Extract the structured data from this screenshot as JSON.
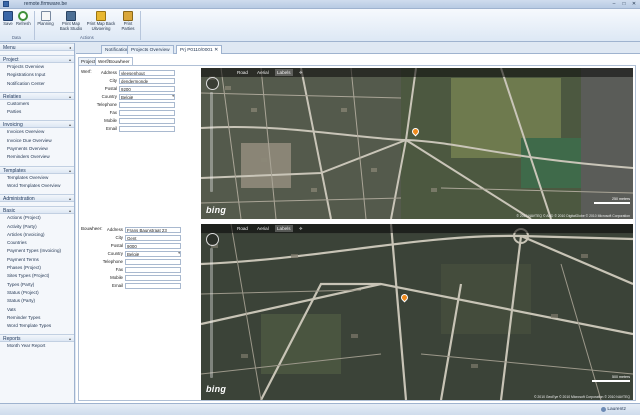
{
  "window": {
    "title": "remote.firmware.be",
    "minimize": "–",
    "maximize": "□",
    "close": "✕"
  },
  "ribbon": {
    "buttons": [
      {
        "label": "Save",
        "icon": "save-icon"
      },
      {
        "label": "Refresh",
        "icon": "refresh-icon"
      },
      {
        "label": "Planning",
        "icon": "planning-icon"
      },
      {
        "label": "Print Map Back Studio",
        "icon": "print-map-studio-icon"
      },
      {
        "label": "Print Map Back Uitvoering",
        "icon": "print-map-uitvoering-icon"
      },
      {
        "label": "Print Parties",
        "icon": "print-parties-icon"
      }
    ],
    "groups": {
      "data": "Data",
      "actions": "Actions"
    }
  },
  "sidebar": {
    "menu": "Menu",
    "sections": [
      {
        "title": "Project",
        "items": [
          "Projects Overview",
          "Registrations Input",
          "Notification Center"
        ]
      },
      {
        "title": "Relaties",
        "items": [
          "Customers",
          "Parties"
        ]
      },
      {
        "title": "Invoicing",
        "items": [
          "Invoices Overview",
          "Invoice Due Overview",
          "Payments Overview",
          "Reminders Overview"
        ]
      },
      {
        "title": "Templates",
        "items": [
          "Templates Overview",
          "Word Templates Overview"
        ]
      },
      {
        "title": "Administration",
        "items": []
      },
      {
        "title": "Basic",
        "items": [
          "Actions (Project)",
          "Activity (Party)",
          "Articles (Invoicing)",
          "Countries",
          "Payment Types (Invoicing)",
          "Payment Terms",
          "Phases (Project)",
          "Sites Types (Project)",
          "Types (Party)",
          "Status (Project)",
          "Status (Party)",
          "Vats",
          "Reminder Types",
          "Word Template Types"
        ]
      },
      {
        "title": "Reports",
        "items": [
          "Month Year Report"
        ]
      }
    ]
  },
  "doc_tabs": [
    "Notification Center",
    "Projects Overview",
    "Prj P0110/0001"
  ],
  "inner_tabs": [
    "Project",
    "Werf/Bouwheer Adres"
  ],
  "werf": {
    "section": "Werf:",
    "labels": {
      "address": "Address",
      "city": "City",
      "postal": "Postal",
      "country": "Country",
      "telephone": "Telephone",
      "fax": "Fax",
      "mobile": "Mobile",
      "email": "Email"
    },
    "values": {
      "address": "vleesenhout",
      "city": "dendermonde",
      "postal": "9200",
      "country": "België",
      "telephone": "",
      "fax": "",
      "mobile": "",
      "email": ""
    }
  },
  "bouwheer": {
    "section": "Bouwheer:",
    "labels": {
      "address": "Address",
      "city": "City",
      "postal": "Postal",
      "country": "Country",
      "telephone": "Telephone",
      "fax": "Fax",
      "mobile": "Mobile",
      "email": "Email"
    },
    "values": {
      "address": "Frans Baunstraat 23",
      "city": "Gent",
      "postal": "9000",
      "country": "België",
      "telephone": "",
      "fax": "",
      "mobile": "",
      "email": ""
    }
  },
  "map_controls": {
    "road": "Road",
    "aerial": "Aerial",
    "labels": "Labels",
    "birdseye": "✈"
  },
  "map_top": {
    "logo": "bing",
    "copyright": "© 2010 NAVTEQ  © AND  © 2010 DigitalGlobe  © 2010 Microsoft Corporation",
    "scale": "250 meters"
  },
  "map_bottom": {
    "logo": "bing",
    "copyright": "© 2010 GeoEye  © 2010 Microsoft Corporation  © 2010 NAVTEQ",
    "scale": "500 meters"
  },
  "statusbar": {
    "user": "Laurentz"
  },
  "colors": {
    "accent": "#3a67a8",
    "pin": "#f08a1c",
    "map_bar": "#1a1a1a"
  }
}
